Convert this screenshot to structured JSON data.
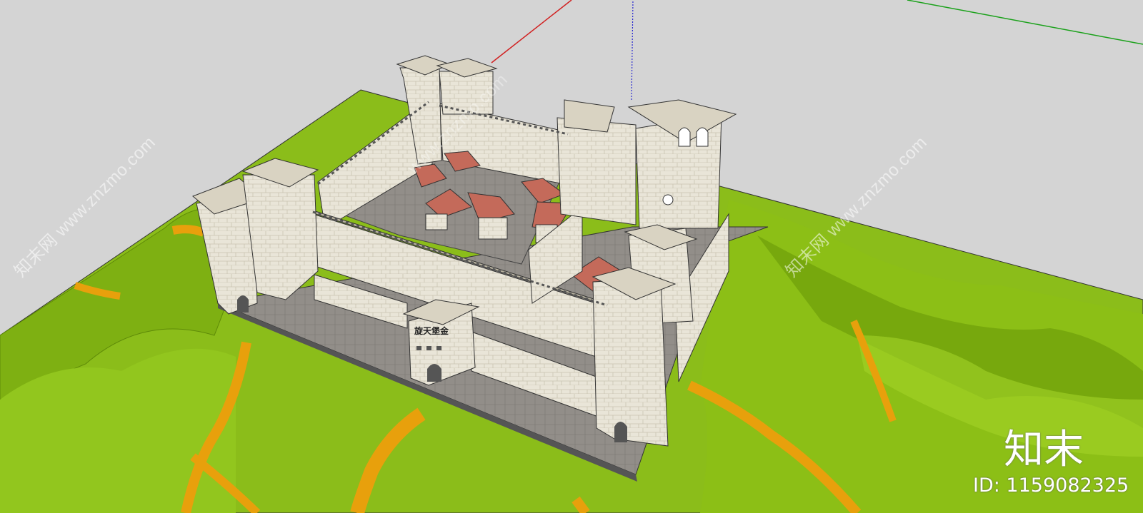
{
  "watermarks": {
    "diagonal_left": "知末网 www.znzmo.com",
    "diagonal_right": "知末网 www.znzmo.com",
    "diagonal_center": "www.znzmo.com"
  },
  "brand": {
    "logo_text": "知末",
    "asset_id": "ID: 1159082325"
  },
  "model": {
    "gate_sign": "旋天堡金"
  },
  "colors": {
    "sky": "#d4d4d4",
    "terrain": "#8bbd1a",
    "terrain_shade": "#5e8a08",
    "path": "#e8a00c",
    "stone": "#e8e4d6",
    "paving": "#8e8a86",
    "roof": "#c46a5a",
    "axis_red": "#d12020",
    "axis_green": "#1aa11a",
    "axis_blue": "#2a2ad0"
  }
}
